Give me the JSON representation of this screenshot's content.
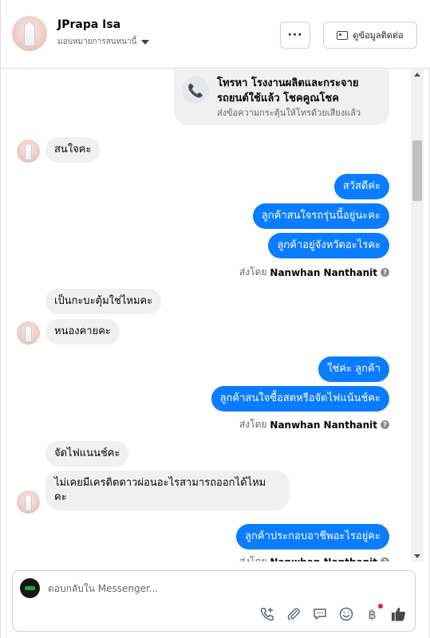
{
  "header": {
    "contact_name": "JPrapa Isa",
    "assign_label": "มอบหมายการสนทนานี้",
    "more_label": "···",
    "contact_button": "ดูข้อมูลติดต่อ"
  },
  "call_card": {
    "title": "โทรหา โรงงานผลิตและกระจายรถยนต์ใช้แล้ว โชคคูณโชค",
    "subtitle": "ส่งข้อความกระตุ้นให้โทรด้วยเสียงแล้ว",
    "icon": "phone-icon"
  },
  "messages": {
    "m1": "สนใจคะ",
    "m2": "สวัสดีค่ะ",
    "m3": "ลูกค้าสนใจรถรุ่นนี้อยู่นะคะ",
    "m4": "ลูกค้าอยู่จังหวัดอะไรคะ",
    "m5": "เป็นกะบะตุ้มใช่ไหมคะ",
    "m6": "หนองคายคะ",
    "m7": "ใช่ค่ะ ลูกค้า",
    "m8": "ลูกค้าสนใจซื้อสดหรือจัดไฟแน้นช์คะ",
    "m9": "จัดไฟแนนช์คะ",
    "m10_line1": "ไม่เคยมีเครดิตดาวผ่อนอะไรสามารถออกได้ไหม",
    "m10_line2": "คะ",
    "m11": "ลูกค้าประกอบอาชีพอะไรอยู่คะ"
  },
  "sent_by": {
    "prefix": "ส่งโดย",
    "agent": "Nanwhan Nanthanit",
    "help": "?"
  },
  "composer": {
    "placeholder": "ตอบกลับใน Messenger..."
  },
  "tools": {
    "call": "phone-plus-icon",
    "attach": "paperclip-icon",
    "saved_reply": "chat-bubble-icon",
    "emoji": "smiley-icon",
    "payment": "baht-icon",
    "like": "thumbs-up-icon",
    "like_color": "#1877f2"
  },
  "colors": {
    "outgoing": "#0a7cff",
    "incoming": "#f0f0f0"
  }
}
